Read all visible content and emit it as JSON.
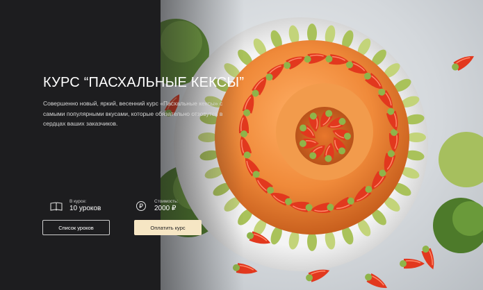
{
  "course": {
    "title": "КУРС “ПАСХАЛЬНЫЕ КЕКСЫ”",
    "description": "Совершенно новый, яркий, весенний курс «Пасхальные кексы» с самыми популярными вкусами, которые обязательно отзовутся в сердцах ваших заказчиков."
  },
  "stats": {
    "lessons": {
      "caption": "В курсе:",
      "value": "10 уроков",
      "icon": "book-icon"
    },
    "price": {
      "caption": "Стоимость:",
      "value": "2000 ₽",
      "icon": "ruble-coin-icon"
    }
  },
  "buttons": {
    "lessons_list": "Список уроков",
    "pay": "Оплатить курс"
  },
  "colors": {
    "background": "#1d1d1f",
    "accent_button": "#f6e6c4",
    "cake_orange": "#f08a3a"
  }
}
